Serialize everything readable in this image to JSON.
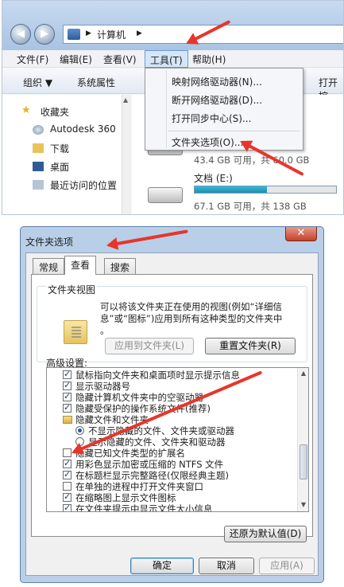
{
  "explorer": {
    "breadcrumb": [
      "计算机"
    ],
    "menu": [
      "文件(F)",
      "编辑(E)",
      "查看(V)",
      "工具(T)",
      "帮助(H)"
    ],
    "toolbar": [
      "组织 ▼",
      "系统属性",
      "打开控"
    ],
    "nav": [
      "收藏夹",
      "Autodesk 360",
      "下载",
      "桌面",
      "最近访问的位置"
    ],
    "tools_menu": [
      "映射网络驱动器(N)...",
      "断开网络驱动器(D)...",
      "打开同步中心(S)...",
      "文件夹选项(O)..."
    ],
    "drive1": {
      "size_text": "43.4 GB 可用，共 60.0 GB",
      "used_fraction": 0.28
    },
    "drive2": {
      "name": "文档 (E:)",
      "size_text": "67.1 GB 可用，共 138 GB",
      "used_fraction": 0.51
    },
    "colors": {
      "accent": "#6a9bd3",
      "arrow": "#e8352b"
    }
  },
  "dialog": {
    "title": "文件夹选项",
    "close": "✕",
    "tabs": [
      "常规",
      "查看",
      "搜索"
    ],
    "folder_view": {
      "label": "文件夹视图",
      "desc_line1": "可以将该文件夹正在使用的视图(例如“详细信",
      "desc_line2": "息”或“图标”)应用到所有这种类型的文件夹中",
      "desc_line3": "。",
      "apply_btn": "应用到文件夹(L)",
      "reset_btn": "重置文件夹(R)"
    },
    "advanced_label": "高级设置:",
    "settings": [
      "鼠标指向文件夹和桌面项时显示提示信息",
      "显示驱动器号",
      "隐藏计算机文件夹中的空驱动器",
      "隐藏受保护的操作系统文件(推荐)",
      "隐藏文件和文件夹",
      "不显示隐藏的文件、文件夹或驱动器",
      "显示隐藏的文件、文件夹和驱动器",
      "隐藏已知文件类型的扩展名",
      "用彩色显示加密或压缩的 NTFS 文件",
      "在标题栏显示完整路径(仅限经典主题)",
      "在单独的进程中打开文件夹窗口",
      "在缩略图上显示文件图标",
      "在文件夹提示中显示文件大小信息"
    ],
    "restore_btn": "还原为默认值(D)",
    "ok_btn": "确定",
    "cancel_btn": "取消",
    "apply_btn": "应用(A)"
  }
}
